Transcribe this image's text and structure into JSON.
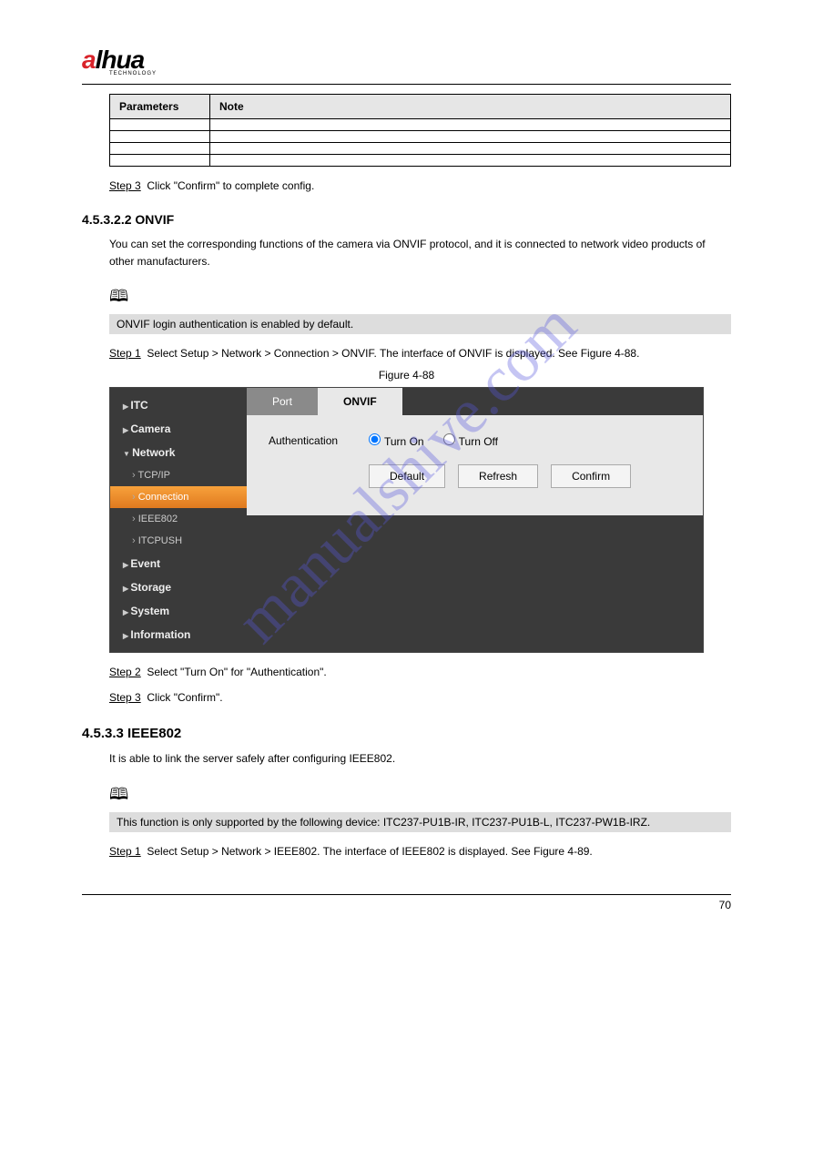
{
  "logo": {
    "letter": "a",
    "rest": "lhua",
    "sub": "TECHNOLOGY"
  },
  "watermark": "manualshive.com",
  "table": {
    "header_param": "Parameters",
    "header_note": "Note",
    "rows": [
      {
        "param": "",
        "note": ""
      },
      {
        "param": "",
        "note": ""
      },
      {
        "param": "",
        "note": ""
      },
      {
        "param": "",
        "note": ""
      }
    ]
  },
  "step3": {
    "label": "Step 3",
    "text": "Click \"Confirm\" to complete config."
  },
  "onvif_section": {
    "heading": "4.5.3.2.2 ONVIF",
    "intro": "You can set the corresponding functions of the camera via ONVIF protocol, and it is connected to network video products of other manufacturers.",
    "note": "ONVIF login authentication is enabled by default."
  },
  "step1": {
    "label": "Step 1",
    "text": "Select Setup > Network > Connection > ONVIF. The interface of ONVIF is displayed. See Figure 4-88."
  },
  "figure88": "Figure 4-88",
  "ui": {
    "nav": {
      "itc": "ITC",
      "camera": "Camera",
      "network": "Network",
      "tcpip": "TCP/IP",
      "connection": "Connection",
      "ieee802": "IEEE802",
      "itcpush": "ITCPUSH",
      "event": "Event",
      "storage": "Storage",
      "system": "System",
      "information": "Information"
    },
    "tabs": {
      "port": "Port",
      "onvif": "ONVIF"
    },
    "form": {
      "auth_label": "Authentication",
      "turn_on": "Turn On",
      "turn_off": "Turn Off"
    },
    "buttons": {
      "default": "Default",
      "refresh": "Refresh",
      "confirm": "Confirm"
    }
  },
  "step2": {
    "label": "Step 2",
    "text": "Select \"Turn On\" for \"Authentication\"."
  },
  "step3b": {
    "label": "Step 3",
    "text": "Click \"Confirm\"."
  },
  "ieee_section": {
    "heading": "4.5.3.3 IEEE802",
    "intro": "It is able to link the server safely after configuring IEEE802.",
    "note": "This function is only supported by the following device: ITC237-PU1B-IR, ITC237-PU1B-L, ITC237-PW1B-IRZ."
  },
  "step1b": {
    "label": "Step 1",
    "text": "Select Setup > Network > IEEE802. The interface of IEEE802 is displayed. See Figure 4-89."
  },
  "page_number": "70"
}
